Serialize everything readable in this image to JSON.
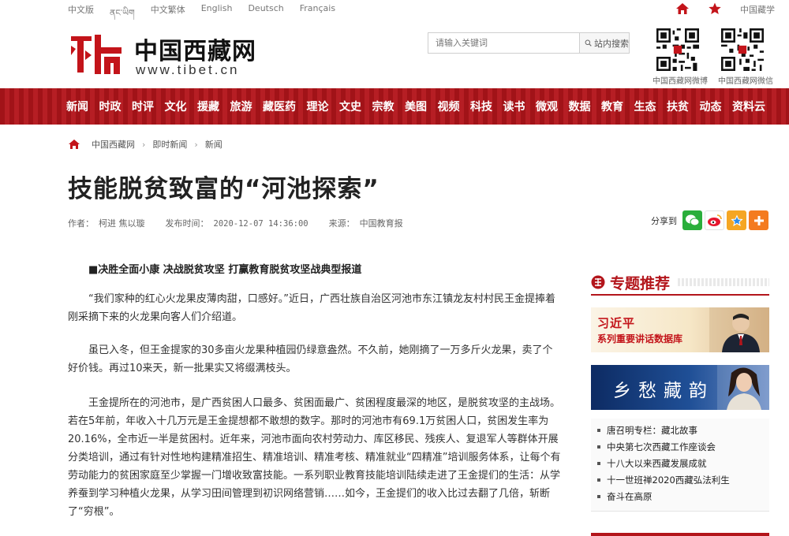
{
  "langbar": {
    "languages": [
      "中文版",
      "ནང་ཡིག",
      "中文繁体",
      "English",
      "Deutsch",
      "Français"
    ],
    "china_link": "中国藏学"
  },
  "header": {
    "logo_text": "中国西藏网",
    "logo_url": "www.tibet.cn",
    "search_placeholder": "请输入关键词",
    "search_button": "站内搜索",
    "qr1_label": "中国西藏网微博",
    "qr2_label": "中国西藏网微信"
  },
  "nav": {
    "items": [
      "新闻",
      "时政",
      "时评",
      "文化",
      "援藏",
      "旅游",
      "藏医药",
      "理论",
      "文史",
      "宗教",
      "美图",
      "视频",
      "科技",
      "读书",
      "微观",
      "数据",
      "教育",
      "生态",
      "扶贫",
      "动态",
      "资料云"
    ]
  },
  "breadcrumb": [
    "中国西藏网",
    "即时新闻",
    "新闻"
  ],
  "article": {
    "title": "技能脱贫致富的“河池探索”",
    "author_label": "作者：",
    "author": "柯进 焦以璇",
    "date_label": "发布时间：",
    "date": "2020-12-07 14:36:00",
    "source_label": "来源：",
    "source": "中国教育报",
    "share_label": "分享到",
    "topic": "■决胜全面小康 决战脱贫攻坚 打赢教育脱贫攻坚战典型报道",
    "paragraphs": [
      "“我们家种的红心火龙果皮薄肉甜，口感好。”近日，广西壮族自治区河池市东江镇龙友村村民王金提捧着刚采摘下来的火龙果向客人们介绍道。",
      "虽已入冬，但王金提家的30多亩火龙果种植园仍绿意盎然。不久前，她刚摘了一万多斤火龙果，卖了个好价钱。再过10来天，新一批果实又将缀满枝头。",
      "王金提所在的河池市，是广西贫困人口最多、贫困面最广、贫困程度最深的地区，是脱贫攻坚的主战场。若在5年前，年收入十几万元是王金提想都不敢想的数字。那时的河池市有69.1万贫困人口，贫困发生率为20.16%，全市近一半是贫困村。近年来，河池市面向农村劳动力、库区移民、残疾人、复退军人等群体开展分类培训，通过有针对性地构建精准招生、精准培训、精准考核、精准就业“四精准”培训服务体系，让每个有劳动能力的贫困家庭至少掌握一门增收致富技能。一系列职业教育技能培训陆续走进了王金提们的生活：从学养蚕到学习种植火龙果，从学习田间管理到初识网络营销……如今，王金提们的收入比过去翻了几倍，斩断了“穷根”。"
    ]
  },
  "sidebar": {
    "title": "专题推荐",
    "banner1_line1": "习近平",
    "banner1_line2": "系列重要讲话数据库",
    "banner2_text": "乡愁藏韵",
    "items": [
      "唐召明专栏：藏北故事",
      "中央第七次西藏工作座谈会",
      "十八大以来西藏发展成就",
      "十一世班禅2020西藏弘法利生",
      "奋斗在高原"
    ]
  },
  "colors": {
    "brand_red": "#b3151b",
    "text_dark": "#222222"
  }
}
